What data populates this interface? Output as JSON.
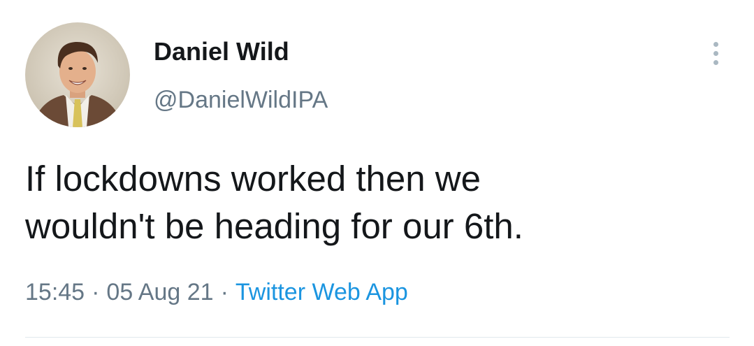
{
  "author": {
    "display_name": "Daniel Wild",
    "handle": "@DanielWildIPA",
    "avatar_icon": "profile-photo"
  },
  "tweet": {
    "lines": [
      "If lockdowns worked then we",
      "wouldn't be heading for our 6th."
    ],
    "time": "15:45",
    "date": "05 Aug 21",
    "separator": "·",
    "source": "Twitter Web App"
  },
  "menu": {
    "icon": "more-vertical-icon"
  },
  "colors": {
    "text": "#14171a",
    "secondary": "#657786",
    "link": "#1b95e0",
    "divider": "#e1e8ed"
  }
}
